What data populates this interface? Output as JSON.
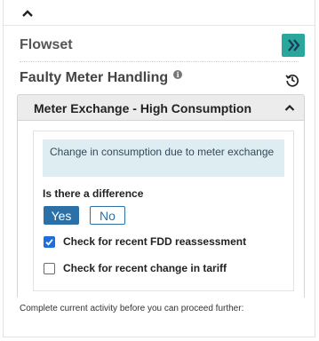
{
  "icons": {
    "collapse": "chevron-up-icon",
    "flowset_action": "double-chevron-right-icon",
    "info": "info-icon",
    "history": "history-icon",
    "accordion_toggle": "chevron-up-icon",
    "check": "checkmark-icon"
  },
  "colors": {
    "flowset_button": "#2aa79b",
    "primary": "#2b70a7",
    "info_bg": "#deedf2",
    "checkbox_checked": "#1e6fd9"
  },
  "flowset": {
    "title": "Flowset"
  },
  "section": {
    "title": "Faulty Meter Handling",
    "info_glyph": "i"
  },
  "accordion": {
    "title": "Meter Exchange - High Consumption",
    "expanded": true,
    "info_text": "Change in consumption due to meter exchange",
    "question": "Is there a difference",
    "yes_label": "Yes",
    "no_label": "No",
    "selected_answer": "Yes",
    "checkboxes": [
      {
        "label": "Check for recent FDD reassessment",
        "checked": true
      },
      {
        "label": "Check for recent change in tariff",
        "checked": false
      }
    ]
  },
  "footer": {
    "note": "Complete current activity before you can proceed further:"
  }
}
